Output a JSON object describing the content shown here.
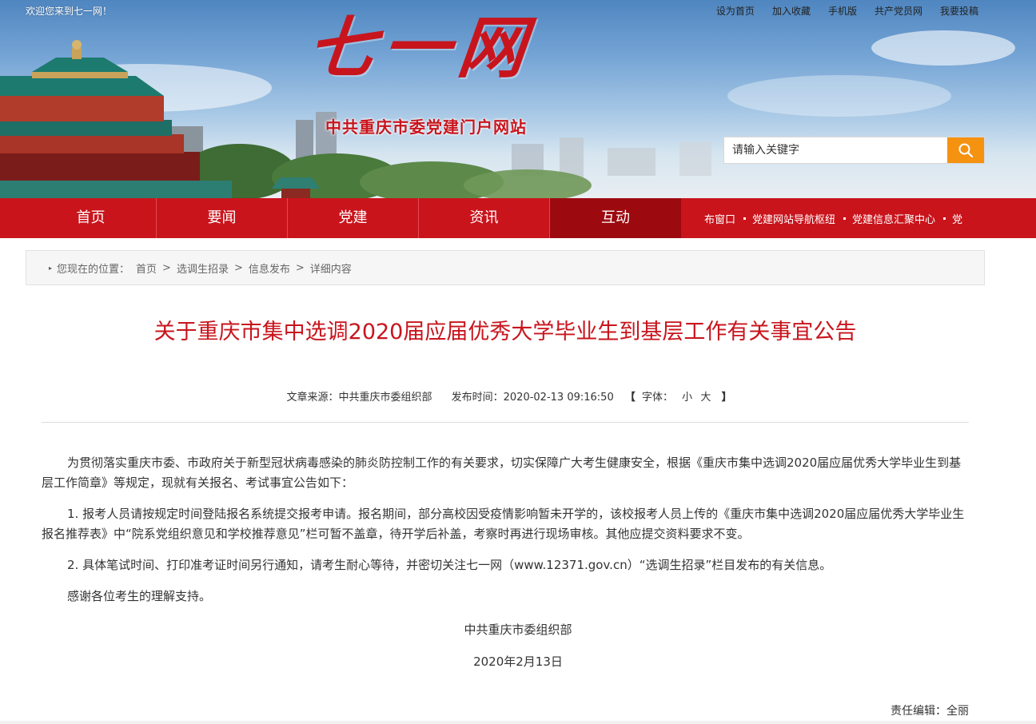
{
  "topbar": {
    "welcome": "欢迎您来到七一网！",
    "links": [
      "设为首页",
      "加入收藏",
      "手机版",
      "共产党员网",
      "我要投稿"
    ]
  },
  "header": {
    "logo_title": "七一网",
    "logo_subtitle": "中共重庆市委党建门户网站"
  },
  "search": {
    "placeholder": "请输入关键字",
    "icon": "search-icon"
  },
  "nav": {
    "items": [
      "首页",
      "要闻",
      "党建",
      "资讯",
      "互动"
    ],
    "active_index": 4,
    "links": [
      "布窗口",
      "党建网站导航枢纽",
      "党建信息汇聚中心",
      "党"
    ]
  },
  "breadcrumb": {
    "prefix": "您现在的位置：",
    "items": [
      "首页",
      "选调生招录",
      "信息发布",
      "详细内容"
    ]
  },
  "article": {
    "title": "关于重庆市集中选调2020届应届优秀大学毕业生到基层工作有关事宜公告",
    "meta": {
      "source": "文章来源：中共重庆市委组织部",
      "time": "发布时间：2020-02-13 09:16:50",
      "font_open": "【",
      "font_label": "字体：",
      "font_small": "小",
      "font_large": "大",
      "font_close": "】"
    },
    "paragraphs": [
      "为贯彻落实重庆市委、市政府关于新型冠状病毒感染的肺炎防控制工作的有关要求，切实保障广大考生健康安全，根据《重庆市集中选调2020届应届优秀大学毕业生到基层工作简章》等规定，现就有关报名、考试事宜公告如下：",
      "1. 报考人员请按规定时间登陆报名系统提交报考申请。报名期间，部分高校因受疫情影响暂未开学的，该校报考人员上传的《重庆市集中选调2020届应届优秀大学毕业生报名推荐表》中“院系党组织意见和学校推荐意见”栏可暂不盖章，待开学后补盖，考察时再进行现场审核。其他应提交资料要求不变。",
      "2. 具体笔试时间、打印准考证时间另行通知，请考生耐心等待，并密切关注七一网（www.12371.gov.cn）“选调生招录”栏目发布的有关信息。",
      "感谢各位考生的理解支持。"
    ],
    "signature": "中共重庆市委组织部",
    "date": "2020年2月13日",
    "editor": "责任编辑：全丽"
  },
  "colors": {
    "brand_red": "#c8151d",
    "nav_red": "#c9141c",
    "nav_active": "#9c0a10",
    "search_button": "#f59210"
  }
}
